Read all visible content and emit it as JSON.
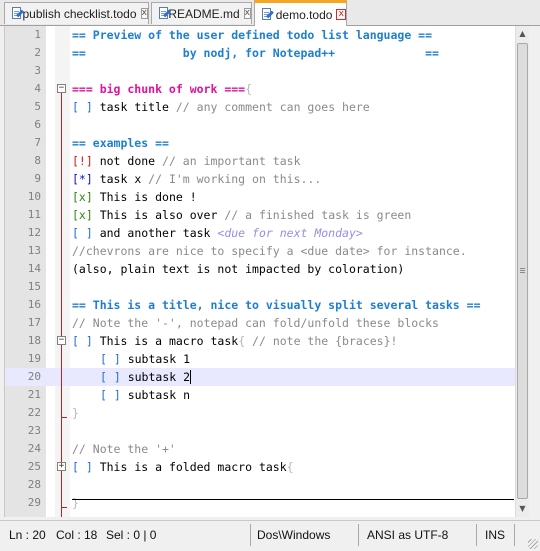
{
  "tabs": [
    {
      "label": "publish checklist.todo",
      "active": false
    },
    {
      "label": "README.md",
      "active": false
    },
    {
      "label": "demo.todo",
      "active": true
    }
  ],
  "close_glyph": "x",
  "lines": [
    {
      "n": "1",
      "segs": [
        {
          "c": "hdr",
          "t": "== Preview of the user defined todo list language =="
        }
      ]
    },
    {
      "n": "2",
      "segs": [
        {
          "c": "hdr",
          "t": "==              by nodj, for Notepad++             =="
        }
      ]
    },
    {
      "n": "3",
      "segs": []
    },
    {
      "n": "4",
      "segs": [
        {
          "c": "big",
          "t": "=== big chunk of work ==="
        },
        {
          "c": "brace",
          "t": "{"
        }
      ]
    },
    {
      "n": "5",
      "segs": [
        {
          "c": "todo",
          "t": "[ ]"
        },
        {
          "c": "",
          "t": " task title "
        },
        {
          "c": "cmt",
          "t": "// any comment can goes here"
        }
      ]
    },
    {
      "n": "6",
      "segs": []
    },
    {
      "n": "7",
      "segs": [
        {
          "c": "hdr",
          "t": "== examples =="
        }
      ]
    },
    {
      "n": "8",
      "segs": [
        {
          "c": "imp",
          "t": "[!]"
        },
        {
          "c": "",
          "t": " not done "
        },
        {
          "c": "cmt",
          "t": "// an important task"
        }
      ]
    },
    {
      "n": "9",
      "segs": [
        {
          "c": "work",
          "t": "[*]"
        },
        {
          "c": "",
          "t": " task x "
        },
        {
          "c": "cmt",
          "t": "// I'm working on this..."
        }
      ]
    },
    {
      "n": "10",
      "segs": [
        {
          "c": "done",
          "t": "[x]"
        },
        {
          "c": "",
          "t": " This is done !"
        }
      ]
    },
    {
      "n": "11",
      "segs": [
        {
          "c": "done",
          "t": "[x]"
        },
        {
          "c": "",
          "t": " This is also over "
        },
        {
          "c": "cmt",
          "t": "// a finished task is green"
        }
      ]
    },
    {
      "n": "12",
      "segs": [
        {
          "c": "todo",
          "t": "[ ]"
        },
        {
          "c": "",
          "t": " and another task "
        },
        {
          "c": "due",
          "t": "<due for next Monday>"
        }
      ]
    },
    {
      "n": "13",
      "segs": [
        {
          "c": "cmt",
          "t": "//chevrons are nice to specify a <due date> for instance."
        }
      ]
    },
    {
      "n": "14",
      "segs": [
        {
          "c": "",
          "t": "(also, plain text is not impacted by coloration)"
        }
      ]
    },
    {
      "n": "15",
      "segs": []
    },
    {
      "n": "16",
      "segs": [
        {
          "c": "hdr",
          "t": "== This is a title, nice to visually split several tasks =="
        }
      ]
    },
    {
      "n": "17",
      "segs": [
        {
          "c": "cmt",
          "t": "// Note the '-', notepad can fold/unfold these blocks"
        }
      ]
    },
    {
      "n": "18",
      "segs": [
        {
          "c": "todo",
          "t": "[ ]"
        },
        {
          "c": "",
          "t": " This is a macro task"
        },
        {
          "c": "brace",
          "t": "{"
        },
        {
          "c": "cmt",
          "t": " // note the {braces}!"
        }
      ]
    },
    {
      "n": "19",
      "indent": true,
      "segs": [
        {
          "c": "todo",
          "t": "[ ]"
        },
        {
          "c": "",
          "t": " subtask 1"
        }
      ]
    },
    {
      "n": "20",
      "indent": true,
      "current": true,
      "segs": [
        {
          "c": "todo",
          "t": "[ ]"
        },
        {
          "c": "",
          "t": " subtask 2"
        }
      ]
    },
    {
      "n": "21",
      "indent": true,
      "segs": [
        {
          "c": "todo",
          "t": "[ ]"
        },
        {
          "c": "",
          "t": " subtask n"
        }
      ]
    },
    {
      "n": "22",
      "segs": [
        {
          "c": "brace",
          "t": "}"
        }
      ]
    },
    {
      "n": "23",
      "segs": []
    },
    {
      "n": "24",
      "segs": [
        {
          "c": "cmt",
          "t": "// Note the '+'"
        }
      ]
    },
    {
      "n": "25",
      "segs": [
        {
          "c": "todo",
          "t": "[ ]"
        },
        {
          "c": "",
          "t": " This is a folded macro task"
        },
        {
          "c": "brace",
          "t": "{"
        }
      ]
    },
    {
      "n": "28",
      "segs": []
    },
    {
      "n": "29",
      "segs": [
        {
          "c": "brace",
          "t": "}"
        }
      ]
    }
  ],
  "status": {
    "ln": "Ln : 20",
    "col": "Col : 18",
    "sel": "Sel : 0 | 0",
    "eol": "Dos\\Windows",
    "encoding": "ANSI as UTF-8",
    "mode": "INS"
  }
}
